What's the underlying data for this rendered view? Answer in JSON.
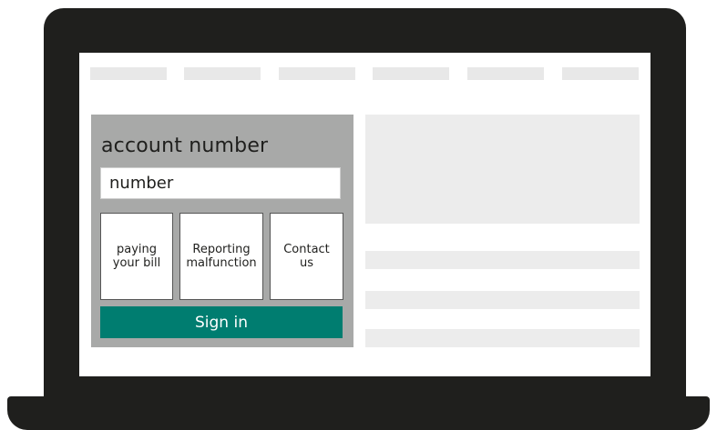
{
  "nav": {
    "items": [
      "",
      "",
      "",
      "",
      "",
      ""
    ]
  },
  "signin_panel": {
    "title": "account number",
    "input": {
      "value": "number"
    },
    "options": [
      {
        "label": "paying\nyour bill"
      },
      {
        "label": "Reporting\nmalfunction"
      },
      {
        "label": "Contact\nus"
      }
    ],
    "submit_label": "Sign in"
  },
  "colors": {
    "laptop": "#1f1f1d",
    "panel_bg": "#a8a9a8",
    "accent": "#007d70",
    "placeholder": "#ececec"
  }
}
